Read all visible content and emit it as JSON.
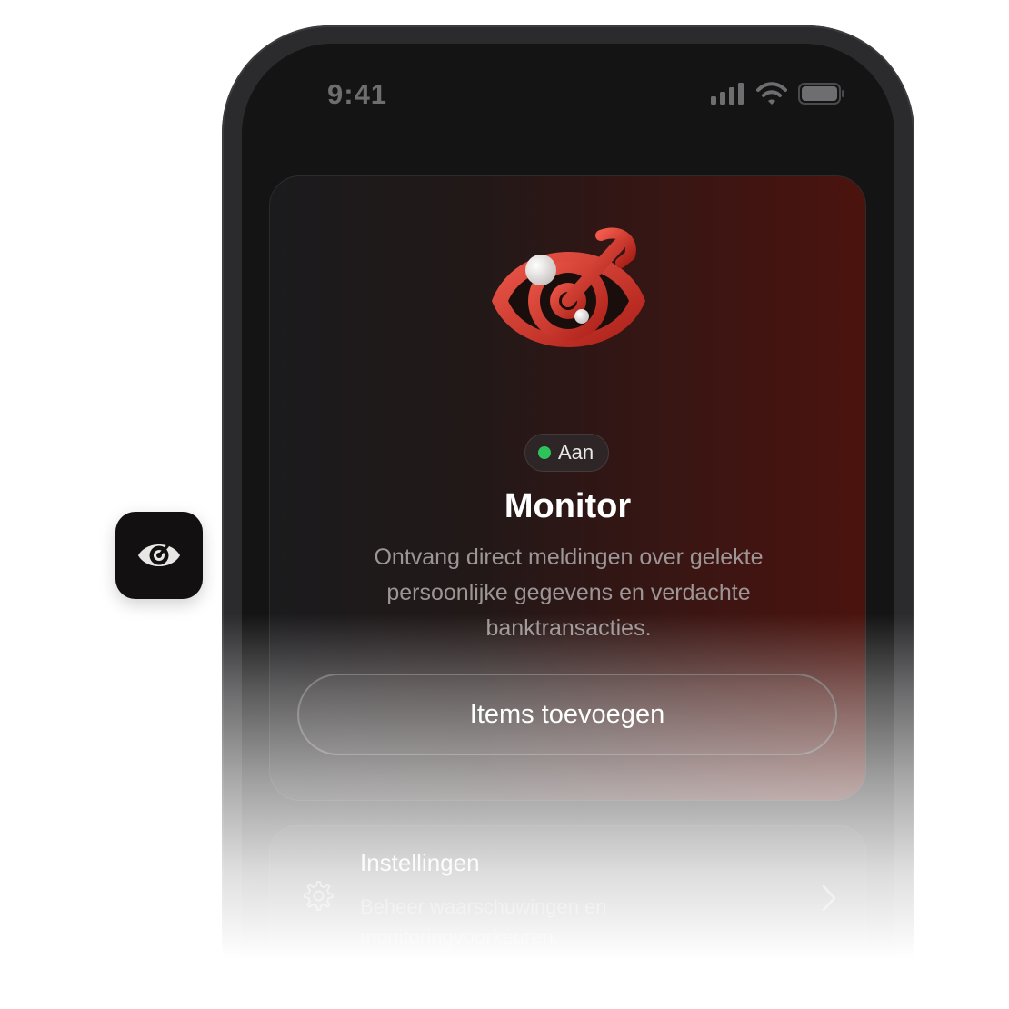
{
  "status_bar": {
    "time": "9:41",
    "icons": [
      "cellular-signal-icon",
      "wifi-icon",
      "battery-icon"
    ]
  },
  "app_icon": {
    "icon": "eye-radar-icon"
  },
  "monitor_card": {
    "status_label": "Aan",
    "status_color": "#2ec25c",
    "title": "Monitor",
    "description": "Ontvang direct meldingen over gelekte persoonlijke gegevens en verdachte banktransacties.",
    "button_label": "Items toevoegen"
  },
  "settings_row": {
    "icon": "gear-icon",
    "title": "Instellingen",
    "description": "Beheer waarschuwingen en monitoringvoorkeuren.",
    "trailing_icon": "chevron-right-icon"
  },
  "colors": {
    "accent_red": "#d8332a",
    "card_gradient_end": "#4b130e",
    "background": "#141415"
  }
}
